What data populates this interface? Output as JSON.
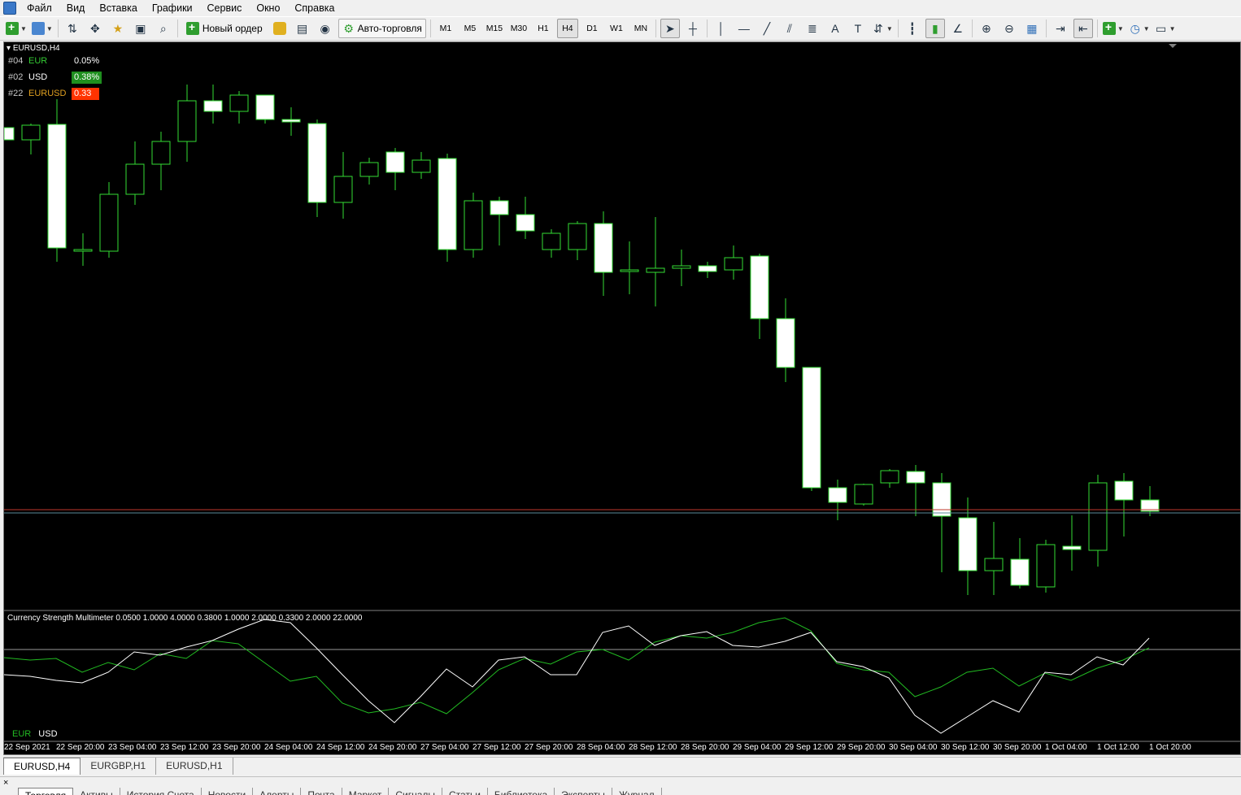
{
  "menu": [
    "Файл",
    "Вид",
    "Вставка",
    "Графики",
    "Сервис",
    "Окно",
    "Справка"
  ],
  "toolbar": {
    "new_order_label": "Новый ордер",
    "autotrading_label": "Авто-торговля",
    "timeframes": [
      "M1",
      "M5",
      "M15",
      "M30",
      "H1",
      "H4",
      "D1",
      "W1",
      "MN"
    ],
    "active_timeframe": "H4"
  },
  "chart": {
    "title": "EURUSD,H4",
    "info_rows": [
      {
        "rank": "#04",
        "name": "EUR",
        "value": "0.05%",
        "name_color": "#33cc33",
        "bg": "transparent",
        "fg": "#ffffff"
      },
      {
        "rank": "#02",
        "name": "USD",
        "value": "0.38%",
        "name_color": "#ffffff",
        "bg": "#1f8f1f",
        "fg": "#ffffff"
      },
      {
        "rank": "#22",
        "name": "EURUSD",
        "value": "0.33",
        "name_color": "#e0a020",
        "bg": "#ff3300",
        "fg": "#ffffff"
      }
    ],
    "candle_border_color": "#33dd33",
    "bull_fill": "#000000",
    "bear_fill": "#ffffff",
    "bid_line_color": "#c0392b",
    "ask_line_color": "#5a8a9a"
  },
  "indicator": {
    "title": "Currency Strength Multimeter 0.0500 1.0000 4.0000 0.3800 1.0000 2.0000 0.3300 2.0000 22.0000",
    "legend": [
      {
        "name": "EUR",
        "color": "#22bb22"
      },
      {
        "name": "USD",
        "color": "#ffffff"
      }
    ]
  },
  "time_axis": [
    "22 Sep 2021",
    "22 Sep 20:00",
    "23 Sep 04:00",
    "23 Sep 12:00",
    "23 Sep 20:00",
    "24 Sep 04:00",
    "24 Sep 12:00",
    "24 Sep 20:00",
    "27 Sep 04:00",
    "27 Sep 12:00",
    "27 Sep 20:00",
    "28 Sep 04:00",
    "28 Sep 12:00",
    "28 Sep 20:00",
    "29 Sep 04:00",
    "29 Sep 12:00",
    "29 Sep 20:00",
    "30 Sep 04:00",
    "30 Sep 12:00",
    "30 Sep 20:00",
    "1 Oct 04:00",
    "1 Oct 12:00",
    "1 Oct 20:00"
  ],
  "chart_tabs": [
    "EURUSD,H4",
    "EURGBP,H1",
    "EURUSD,H1"
  ],
  "active_chart_tab": "EURUSD,H4",
  "terminal": {
    "close_label": "×",
    "tabs": [
      "Торговля",
      "Активы",
      "История Счета",
      "Новости",
      "Алерты",
      "Почта",
      "Маркет",
      "Сигналы",
      "Статьи",
      "Библиотека",
      "Эксперты",
      "Журнал"
    ]
  }
}
